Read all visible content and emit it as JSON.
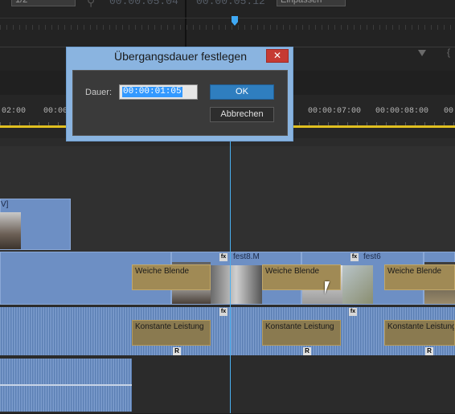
{
  "monitor": {
    "scale_select": "1/2",
    "source_timecode": "00:00:05:04",
    "program_timecode": "00:00:05:12",
    "fit_select": "Einpassen"
  },
  "ruler": {
    "ticks": [
      "02:00",
      "00:00",
      "00:00:07:00",
      "00:00:08:00",
      "00"
    ]
  },
  "tracks": {
    "video1_label": "V]",
    "clip1_name": "fest8.M",
    "clip2_name": "fest6",
    "video_transitions": [
      "Weiche Blende",
      "Weiche Blende",
      "Weiche Blende"
    ],
    "audio_transitions": [
      "Konstante Leistung",
      "Konstante Leistung",
      "Konstante Leistung"
    ],
    "fx_badge": "fx",
    "r_badge": "R"
  },
  "dialog": {
    "title": "Übergangsdauer festlegen",
    "close_label": "✕",
    "duration_label": "Dauer:",
    "duration_value": "00:00:01:05",
    "ok_label": "OK",
    "cancel_label": "Abbrechen"
  },
  "colors": {
    "accent": "#2f7ebf",
    "playhead": "#4ab0f0",
    "video_clip": "#6d8fc4",
    "transition": "#a08a55",
    "close": "#c63a33"
  }
}
